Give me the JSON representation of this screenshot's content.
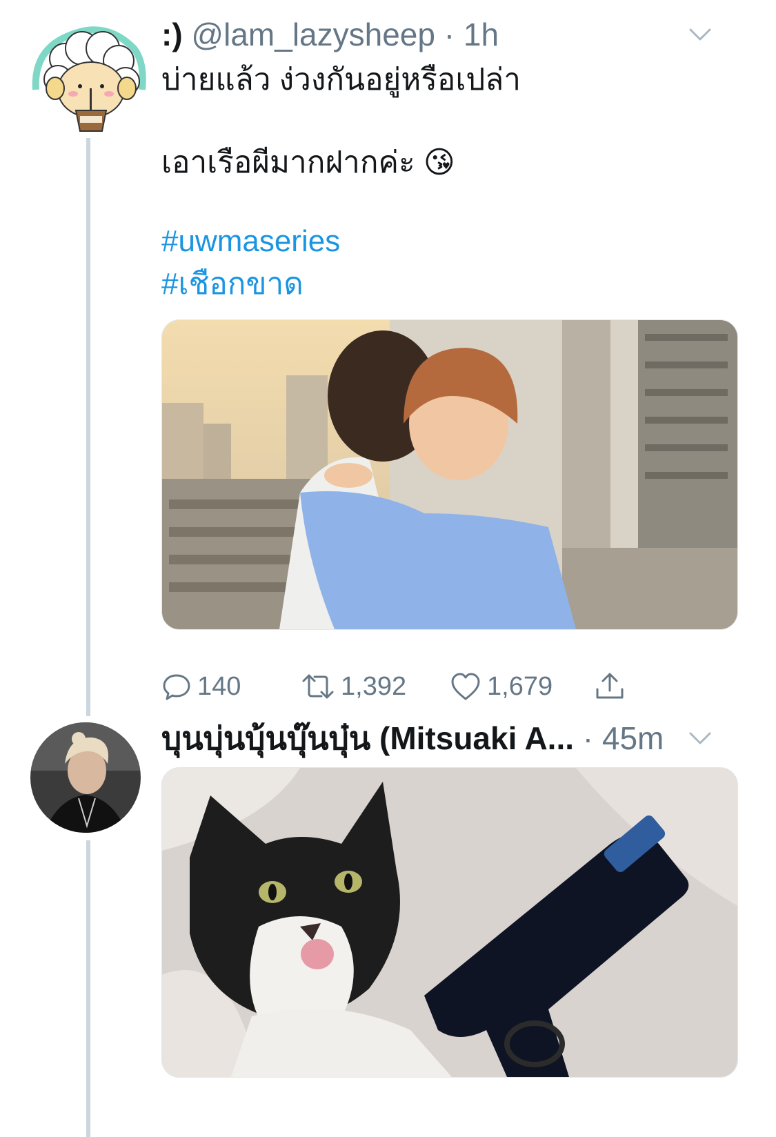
{
  "tweet1": {
    "display_name": ":)",
    "handle": "@lam_lazysheep",
    "separator": "·",
    "time": "1h",
    "avatar_icon": "sheep-cartoon-avatar-icon",
    "text_line1": "บ่ายแล้ว ง่วงกันอยู่หรือเปล่า",
    "text_line2": "เอาเรือผีมากฝากค่ะ",
    "emoji": "😘",
    "hashtags": [
      "#uwmaseries",
      "#เชือกขาด"
    ],
    "media_description_icon": "photo-two-people-hugging",
    "actions": {
      "reply_count": "140",
      "retweet_count": "1,392",
      "like_count": "1,679"
    }
  },
  "tweet2": {
    "display_name": "บุนบุ่นบุ้นบุ๊นบุ๋น (Mitsuaki A...",
    "separator": "·",
    "time": "45m",
    "avatar_icon": "person-photo-avatar-icon",
    "media_description_icon": "photo-cat-with-gun"
  },
  "colors": {
    "link": "#1b95e0",
    "muted": "#657786",
    "thread_line": "#ccd6dd"
  }
}
